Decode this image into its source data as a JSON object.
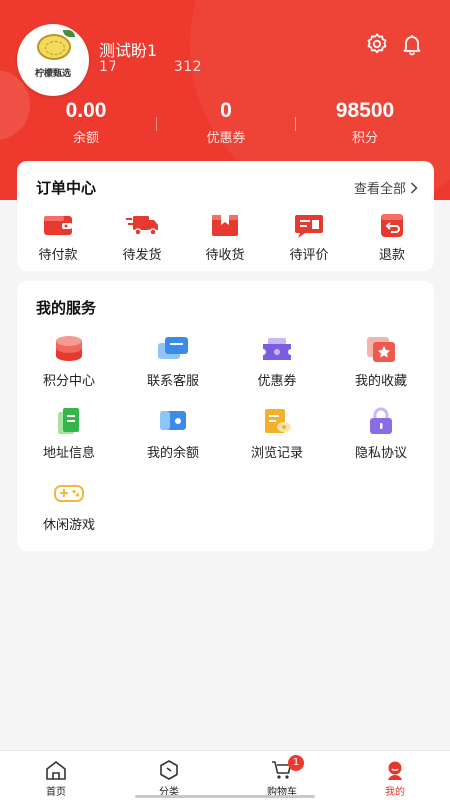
{
  "profile": {
    "brand_name": "柠檬甄选",
    "username": "测试盼1",
    "phone_prefix": "17",
    "phone_suffix": "312"
  },
  "stats": [
    {
      "value": "0.00",
      "label": "余额"
    },
    {
      "value": "0",
      "label": "优惠券"
    },
    {
      "value": "98500",
      "label": "积分"
    }
  ],
  "orders": {
    "title": "订单中心",
    "view_all": "查看全部",
    "items": [
      {
        "label": "待付款",
        "icon": "wallet-icon"
      },
      {
        "label": "待发货",
        "icon": "truck-icon"
      },
      {
        "label": "待收货",
        "icon": "box-icon"
      },
      {
        "label": "待评价",
        "icon": "review-icon"
      },
      {
        "label": "退款",
        "icon": "refund-icon"
      }
    ]
  },
  "services": {
    "title": "我的服务",
    "items": [
      {
        "label": "积分中心",
        "icon": "points-stack-icon"
      },
      {
        "label": "联系客服",
        "icon": "chat-icon"
      },
      {
        "label": "优惠券",
        "icon": "coupon-icon"
      },
      {
        "label": "我的收藏",
        "icon": "favorites-icon"
      },
      {
        "label": "地址信息",
        "icon": "address-icon"
      },
      {
        "label": "我的余额",
        "icon": "balance-card-icon"
      },
      {
        "label": "浏览记录",
        "icon": "history-icon"
      },
      {
        "label": "隐私协议",
        "icon": "lock-icon"
      },
      {
        "label": "休闲游戏",
        "icon": "gamepad-icon"
      }
    ]
  },
  "tabbar": {
    "items": [
      {
        "label": "首页"
      },
      {
        "label": "分类"
      },
      {
        "label": "购物车",
        "badge": "1"
      },
      {
        "label": "我的"
      }
    ]
  },
  "colors": {
    "accent": "#ee3a2e",
    "background": "#f5f5f5"
  }
}
